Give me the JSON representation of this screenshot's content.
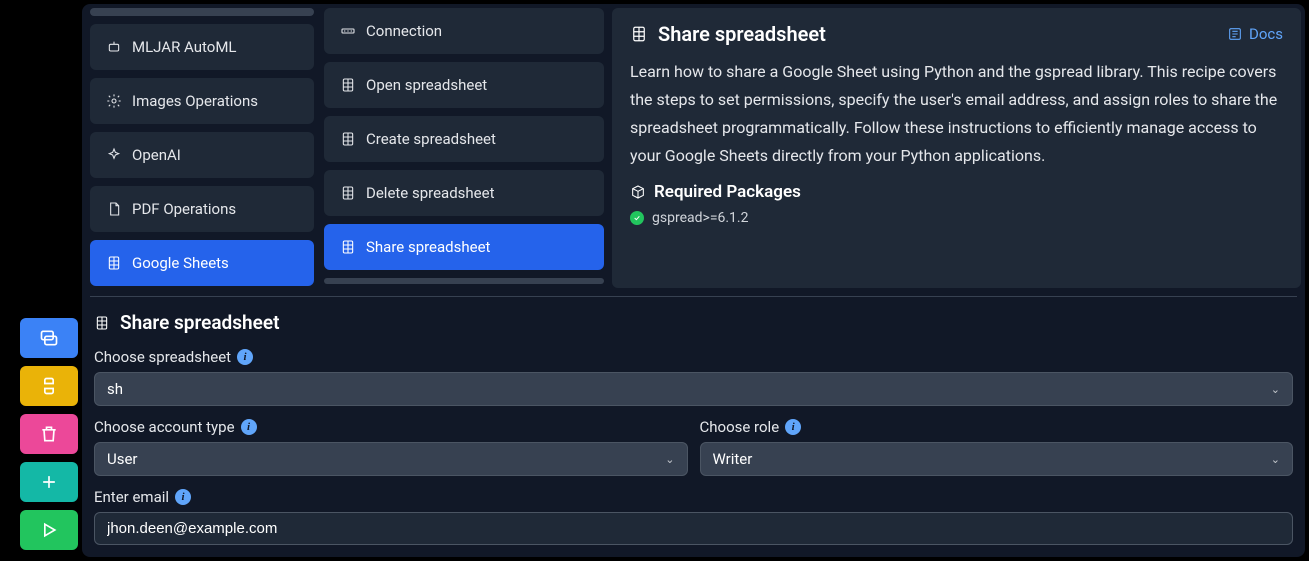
{
  "sidebar_buttons": [
    "chat",
    "python",
    "delete",
    "add",
    "run"
  ],
  "categories": {
    "items": [
      {
        "label": "MLJAR AutoML",
        "icon": "robot"
      },
      {
        "label": "Images Operations",
        "icon": "gear"
      },
      {
        "label": "OpenAI",
        "icon": "sparkle"
      },
      {
        "label": "PDF Operations",
        "icon": "file"
      },
      {
        "label": "Google Sheets",
        "icon": "sheet",
        "active": true
      }
    ]
  },
  "recipes": {
    "items": [
      {
        "label": "Connection",
        "icon": "api"
      },
      {
        "label": "Open spreadsheet",
        "icon": "sheet"
      },
      {
        "label": "Create spreadsheet",
        "icon": "sheet"
      },
      {
        "label": "Delete spreadsheet",
        "icon": "sheet"
      },
      {
        "label": "Share spreadsheet",
        "icon": "sheet",
        "active": true
      }
    ]
  },
  "detail": {
    "title": "Share spreadsheet",
    "docs_label": "Docs",
    "description": "Learn how to share a Google Sheet using Python and the gspread library. This recipe covers the steps to set permissions, specify the user's email address, and assign roles to share the spreadsheet programmatically. Follow these instructions to efficiently manage access to your Google Sheets directly from your Python applications.",
    "required_packages_label": "Required Packages",
    "packages": [
      {
        "name": "gspread>=6.1.2",
        "ok": true
      }
    ]
  },
  "form": {
    "title": "Share spreadsheet",
    "fields": {
      "spreadsheet": {
        "label": "Choose spreadsheet",
        "value": "sh"
      },
      "account_type": {
        "label": "Choose account type",
        "value": "User"
      },
      "role": {
        "label": "Choose role",
        "value": "Writer"
      },
      "email": {
        "label": "Enter email",
        "value": "jhon.deen@example.com"
      }
    }
  }
}
